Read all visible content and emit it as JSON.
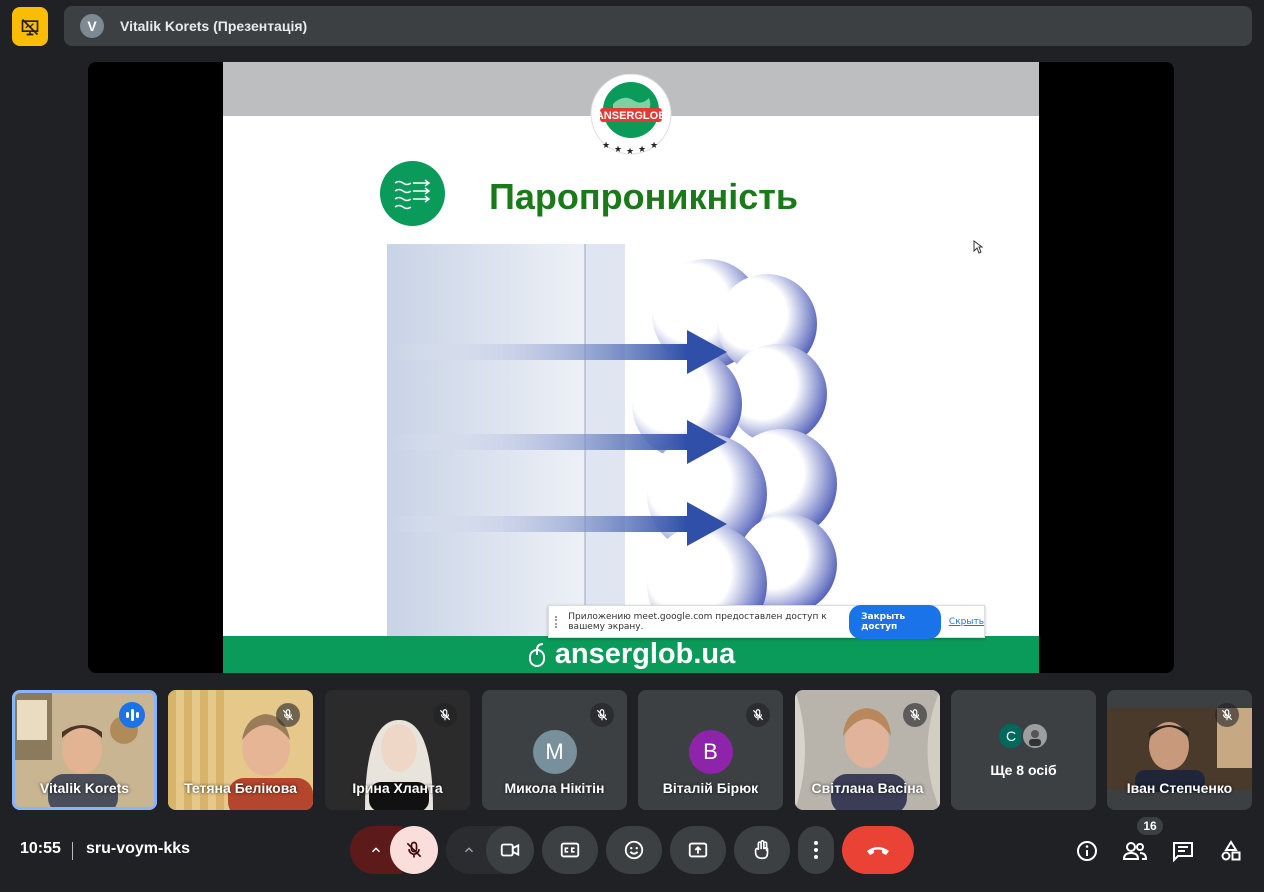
{
  "top": {
    "presenter_initial": "V",
    "title": "Vitalik Korets (Презентація)"
  },
  "slide": {
    "logo_text": "ANSERGLOB",
    "title": "Паропроникність",
    "footer": "anserglob.ua"
  },
  "share_notice": {
    "text": "Приложению meet.google.com предоставлен доступ к вашему экрану.",
    "stop_label": "Закрыть доступ",
    "hide_label": "Скрыть"
  },
  "participants": [
    {
      "name": "Vitalik Korets",
      "speaking": true
    },
    {
      "name": "Тетяна Белікова",
      "muted": true
    },
    {
      "name": "Ірина Хланта",
      "muted": true
    },
    {
      "name": "Микола Нікітін",
      "initial": "M",
      "avatar_color": "#78909c",
      "muted": true
    },
    {
      "name": "Віталій Бірюк",
      "initial": "B",
      "avatar_color": "#8e24aa",
      "muted": true
    },
    {
      "name": "Світлана Васіна",
      "muted": true
    },
    {
      "more_label": "Ще 8 осіб",
      "initial": "C",
      "avatar_color": "#00695c"
    },
    {
      "name": "Іван Степченко",
      "muted": true
    }
  ],
  "bottom": {
    "time": "10:55",
    "meeting_code": "sru-voym-kks",
    "people_count": "16"
  },
  "colors": {
    "accent_blue": "#8ab4f8",
    "end_call_red": "#ea4335",
    "brand_green": "#0a9a59",
    "presenting_yellow": "#fbbc04"
  }
}
